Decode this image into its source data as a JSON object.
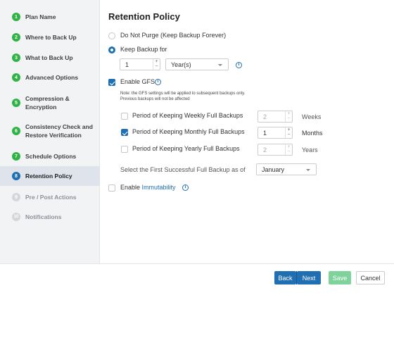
{
  "steps": [
    {
      "num": "1",
      "label": "Plan Name"
    },
    {
      "num": "2",
      "label": "Where to Back Up"
    },
    {
      "num": "3",
      "label": "What to Back Up"
    },
    {
      "num": "4",
      "label": "Advanced Options"
    },
    {
      "num": "5",
      "label": "Compression &\nEncryption"
    },
    {
      "num": "6",
      "label": "Consistency Check and\nRestore Verification"
    },
    {
      "num": "7",
      "label": "Schedule Options"
    },
    {
      "num": "8",
      "label": "Retention Policy"
    },
    {
      "num": "9",
      "label": "Pre / Post Actions"
    },
    {
      "num": "10",
      "label": "Notifications"
    }
  ],
  "page": {
    "title": "Retention Policy",
    "no_purge_label": "Do Not Purge (Keep Backup Forever)",
    "keep_backup_label": "Keep Backup for",
    "keep_value": "1",
    "keep_unit": "Year(s)",
    "gfs_label": "Enable GFS",
    "gfs_note_line1": "Note: the GFS settings will be applied to subsequent backups only.",
    "gfs_note_line2": "Previous backups will not be affected",
    "weekly_label": "Period of Keeping Weekly Full Backups",
    "weekly_value": "2",
    "weekly_unit": "Weeks",
    "monthly_label": "Period of Keeping Monthly Full Backups",
    "monthly_value": "1",
    "monthly_unit": "Months",
    "yearly_label": "Period of Keeping Yearly Full Backups",
    "yearly_value": "2",
    "yearly_unit": "Years",
    "first_backup_label": "Select the First Successful Full Backup as of",
    "first_backup_value": "January",
    "immutability_prefix": "Enable ",
    "immutability_link": "Immutability"
  },
  "footer": {
    "back_label": "Back",
    "next_label": "Next",
    "save_label": "Save",
    "cancel_label": "Cancel"
  },
  "colors": {
    "accent": "#1f6fb2",
    "done_step": "#2fb344",
    "save_button": "#7ed39a"
  }
}
